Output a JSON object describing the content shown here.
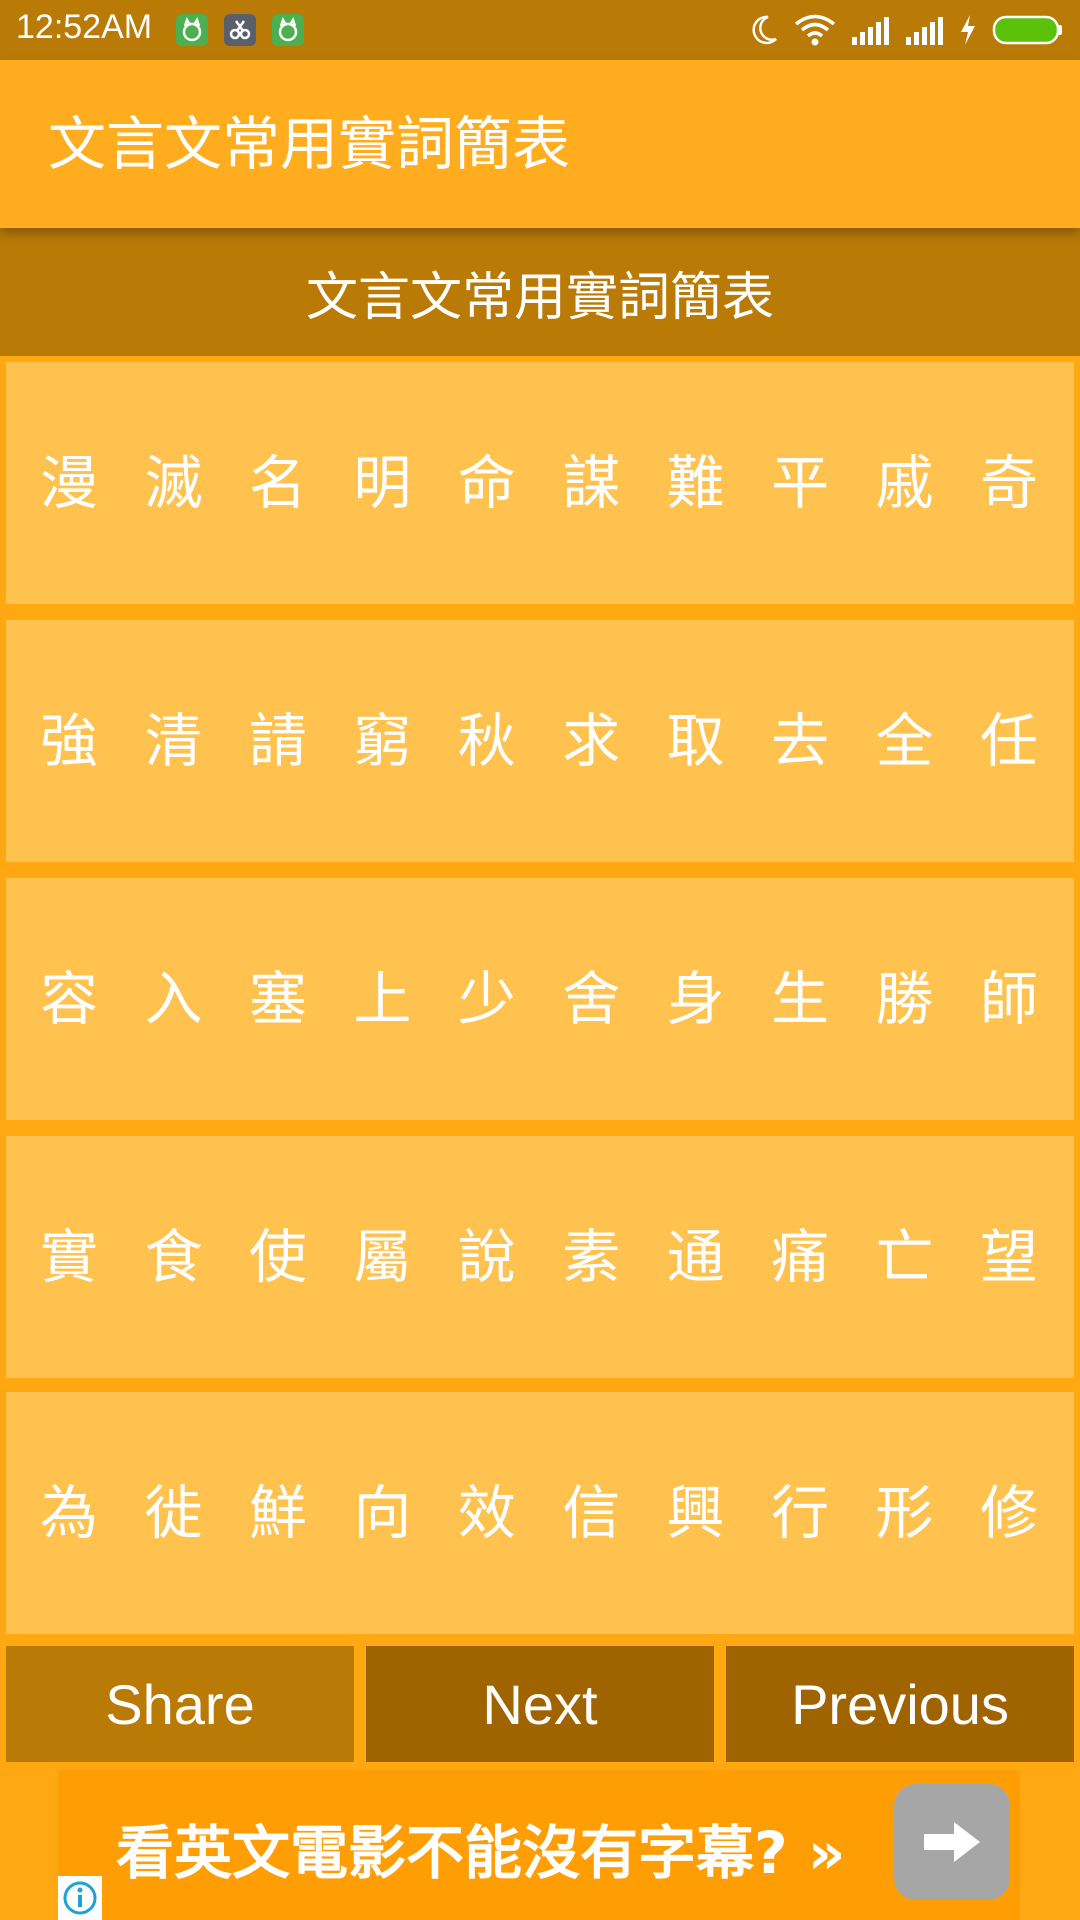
{
  "status_bar": {
    "time": "12:52AM",
    "notification_icons": [
      "android-cat-icon",
      "scissors-app-icon",
      "android-cat-icon"
    ],
    "right_icons": [
      "moon-icon",
      "wifi-icon",
      "signal-icon",
      "signal-icon",
      "charging-icon",
      "battery-icon"
    ]
  },
  "app_bar": {
    "title": "文言文常用實詞簡表"
  },
  "section": {
    "title": "文言文常用實詞簡表"
  },
  "cards": [
    {
      "text": "漫 滅 名 明 命 謀 難 平 戚 奇"
    },
    {
      "text": "強 清 請 窮 秋 求 取 去 全 任"
    },
    {
      "text": "容 入 塞 上 少 舍 身 生 勝 師"
    },
    {
      "text": "實 食 使 屬 說 素 通 痛 亡 望"
    },
    {
      "text": "為 徙 鮮 向 效 信 興 行 形 修"
    }
  ],
  "buttons": {
    "share": "Share",
    "next": "Next",
    "previous": "Previous"
  },
  "ad": {
    "text": "看英文電影不能沒有字幕? »",
    "arrow_icon": "arrow-right-icon",
    "info_icon": "info-icon"
  },
  "colors": {
    "status_bar": "#B97A06",
    "app_bar": "#FFAD1E",
    "section_header": "#B97A06",
    "card": "#FFC24E",
    "background": "#FFA812",
    "button_dark": "#9F6400",
    "ad_background": "#FF9D05"
  }
}
